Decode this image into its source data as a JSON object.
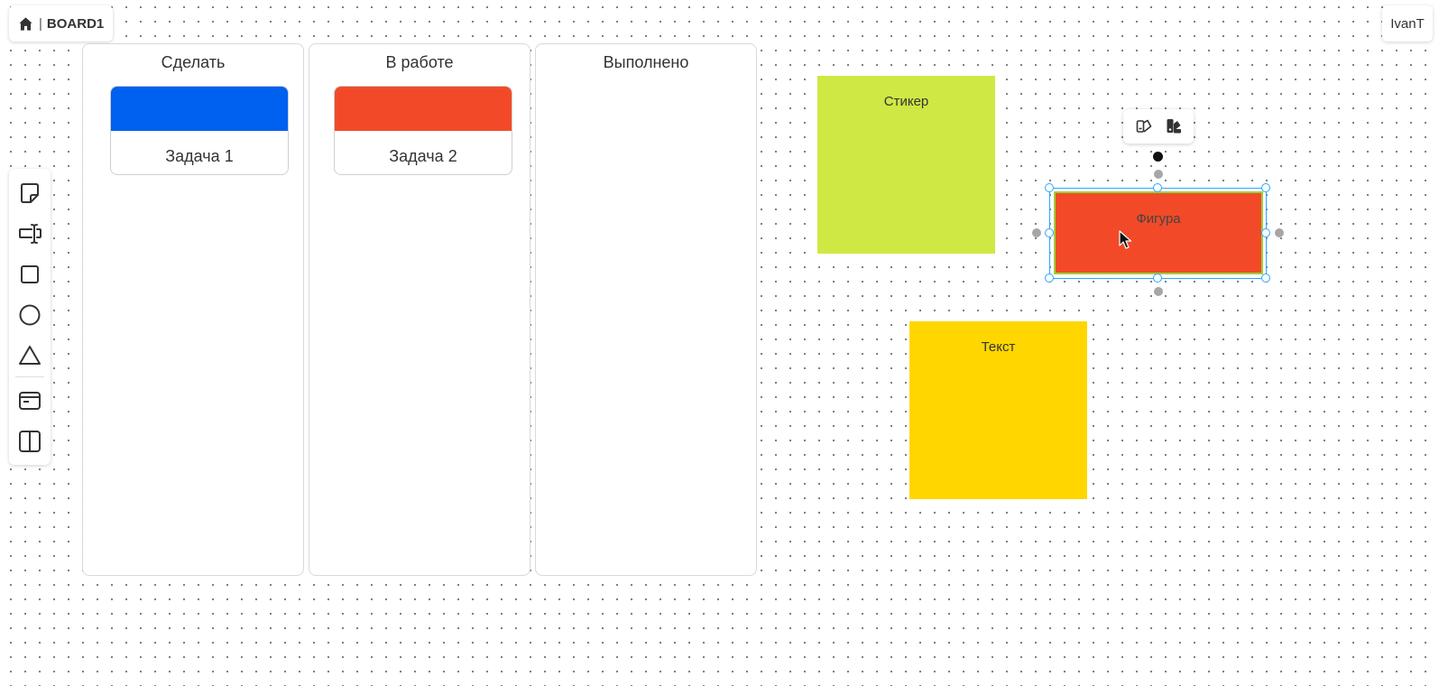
{
  "header": {
    "home_icon": "home-icon",
    "separator": "|",
    "board_name": "BOARD1",
    "user_name": "IvanT"
  },
  "toolbar": {
    "tools": [
      {
        "name": "sticker-tool",
        "icon": "sticky-note-icon"
      },
      {
        "name": "text-tool",
        "icon": "text-cursor-icon"
      },
      {
        "name": "rectangle-tool",
        "icon": "square-icon"
      },
      {
        "name": "ellipse-tool",
        "icon": "circle-icon"
      },
      {
        "name": "triangle-tool",
        "icon": "triangle-icon"
      },
      {
        "name": "card-tool",
        "icon": "card-icon"
      },
      {
        "name": "kanban-tool",
        "icon": "columns-icon"
      }
    ]
  },
  "kanban": {
    "columns": [
      {
        "title": "Сделать",
        "cards": [
          {
            "label": "Задача 1",
            "color": "#0060f0"
          }
        ]
      },
      {
        "title": "В работе",
        "cards": [
          {
            "label": "Задача 2",
            "color": "#f24a28"
          }
        ]
      },
      {
        "title": "Выполнено",
        "cards": []
      }
    ]
  },
  "canvas": {
    "stickers": [
      {
        "label": "Стикер",
        "color": "#d0e843"
      },
      {
        "label": "Текст",
        "color": "#ffd600"
      }
    ],
    "figure": {
      "label": "Фигура",
      "fill": "#f24a28",
      "stroke": "#9bd13b"
    },
    "selection_color": "#2aa7ff",
    "shape_toolbar": [
      {
        "name": "fill-style-button",
        "icon": "fill-style-icon"
      },
      {
        "name": "color-palette-button",
        "icon": "color-palette-icon"
      }
    ]
  }
}
